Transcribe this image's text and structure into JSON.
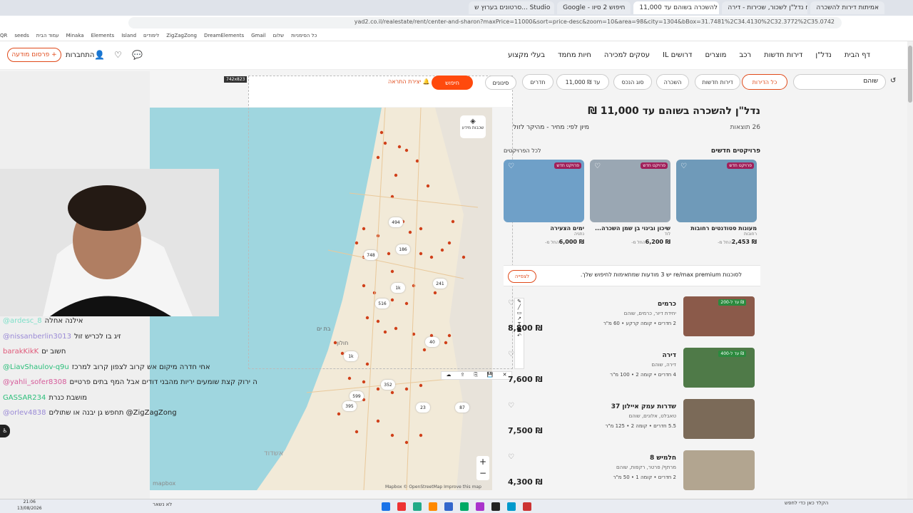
{
  "browser": {
    "tabs": [
      {
        "label": "סרטונים בערוץ ש... Studio"
      },
      {
        "label": "Google - חיפוש 2 סיוו"
      },
      {
        "label": "נדל\"ן להשכרה בשוהם עד 11,000"
      },
      {
        "label": "לוח נדל\"ן לשכור, שכירות - דירה"
      },
      {
        "label": "אמיתות דירות להשכרה"
      }
    ],
    "url": "yad2.co.il/realestate/rent/center-and-sharon?maxPrice=11000&sort=price-desc&zoom=10&area=98&city=1304&bBox=31.7481%2C34.4130%2C32.3772%2C35.0742"
  },
  "bookmarks": [
    "כל הסימניות",
    "שלום",
    "Gmail",
    "DreamElements",
    "ZigZagZong",
    "לימודים",
    "Island",
    "Elements",
    "Minaka",
    "עמוד הבית",
    "seeds",
    "QR"
  ],
  "site": {
    "nav": [
      "דף הבית",
      "נדל\"ן",
      "דירות חדשות",
      "רכב",
      "מוצרים",
      "דרושים IL",
      "עסקים למכירה",
      "חיות מחמד",
      "בעלי מקצוע"
    ],
    "post_button": "פרסום מודעה",
    "login": "התחברות"
  },
  "filters": {
    "search_value": "שוהם",
    "all_apartments": "כל הדירות",
    "new_apartments": "דירות חדשות",
    "rent": "השכרה",
    "property_type": "סוג הנכס",
    "price": "עד ₪ 11,000",
    "rooms": "חדרים",
    "filters": "סינונים",
    "search_btn": "חיפוש",
    "alert": "יצירת התראה"
  },
  "map": {
    "layers_btn": "שכבות מידע",
    "attribution": "Mapbox © OpenStreetMap Improve this map",
    "mapbox_logo": "mapbox",
    "zoom_in": "+",
    "zoom_out": "−",
    "size_badge": "742x823",
    "clusters": [
      "494",
      "748",
      "186",
      "1k",
      "241",
      "516",
      "40",
      "1k",
      "599",
      "352",
      "23",
      "87",
      "395"
    ],
    "labels": [
      "בת ים",
      "חולון",
      "אשדוד"
    ]
  },
  "results": {
    "title": "נדל\"ן להשכרה בשוהם עד 11,000 ₪",
    "count": "26 תוצאות",
    "sort": "מיון לפי: מחיר - מהיקר לזול",
    "projects_title": "פרויקטים חדשים",
    "projects_all": "לכל הפרויקטים",
    "projects": [
      {
        "badge": "פרויקט חדש",
        "name": "מעונות סטודנטים רחובות",
        "loc": "רחובות",
        "price": "₪ 2,453",
        "prefix": "החל מ-",
        "color": "#6f9ab9"
      },
      {
        "badge": "פרויקט חדש",
        "name": "שיכון ובינוי בן שמן השכרה...",
        "loc": "לוד",
        "price": "₪ 6,200",
        "prefix": "החל מ-",
        "color": "#9aa7b3"
      },
      {
        "badge": "פרויקט חדש",
        "name": "ימים הצעירה",
        "loc": "נתניה",
        "price": "₪ 6,000",
        "prefix": "החל מ-",
        "color": "#6fa0c8"
      }
    ],
    "banner": "לסוכנות re/max premium יש 3 מודעות שמתאימות לחיפוש שלך.",
    "banner_btn": "לצפייה",
    "listings": [
      {
        "title": "כרמים",
        "sub": "יחידת דיור, כרמים, שוהם",
        "details": "2 חדרים • קומה קרקע • 60 מ\"ר",
        "price": "₪ 8,800",
        "badge": "עד ל-200 ₪",
        "color": "#8b5a4a"
      },
      {
        "title": "דירה",
        "sub": "דירה, שוהם",
        "details": "4 חדרים • קומה 2 • 100 מ\"ר",
        "price": "₪ 7,600",
        "badge": "עד ל-400 ₪",
        "color": "#4f7a48"
      },
      {
        "title": "שדרות עמק איילון 37",
        "sub": "טאבלט, אלונים, שוהם",
        "details": "5.5 חדרים • קומה 2 • 125 מ\"ר",
        "price": "₪ 7,500",
        "badge": "",
        "color": "#7b6a58"
      },
      {
        "title": "חלמיש 8",
        "sub": "מרתף/ פרטר, רקפות, שוהם",
        "details": "2 חדרים • קומה 1 • 50 מ\"ר",
        "price": "₪ 4,300",
        "badge": "",
        "color": "#b2a590"
      }
    ],
    "agency": "re/max premium"
  },
  "chat": [
    {
      "user": "@ardesc_8",
      "msg": "אילנה אחלה",
      "color": "#7ee0c9"
    },
    {
      "user": "@nissanberlin3013",
      "msg": "זיג בו לכריש זול",
      "color": "#9a8ad6"
    },
    {
      "user": "barakKikK",
      "msg": "חשוב ים",
      "color": "#e05a7a"
    },
    {
      "user": "@LiavShaulov-q9u",
      "msg": "אחי חדרה מיקום אש קרוב לצפון קרוב למרכז",
      "color": "#2bbf7a"
    },
    {
      "user": "@yahli_sofer8308",
      "msg": "ה ירוק קצת שומעים יריות מהבני דודים אבל המף בתים פרטיים",
      "color": "#d65a9a"
    },
    {
      "user": "GASSAR234",
      "msg": "מושבת כנרת",
      "color": "#2bbf7a"
    },
    {
      "user": "@orlev4838",
      "msg": "תחפש גן יבנה או שתולים @ZigZagZong",
      "color": "#9a8ad6"
    }
  ],
  "taskbar": {
    "time": "21:06",
    "date": "13/08/2026",
    "search": "הקלד כאן כדי לחפש",
    "weather": "לא נשאר"
  }
}
